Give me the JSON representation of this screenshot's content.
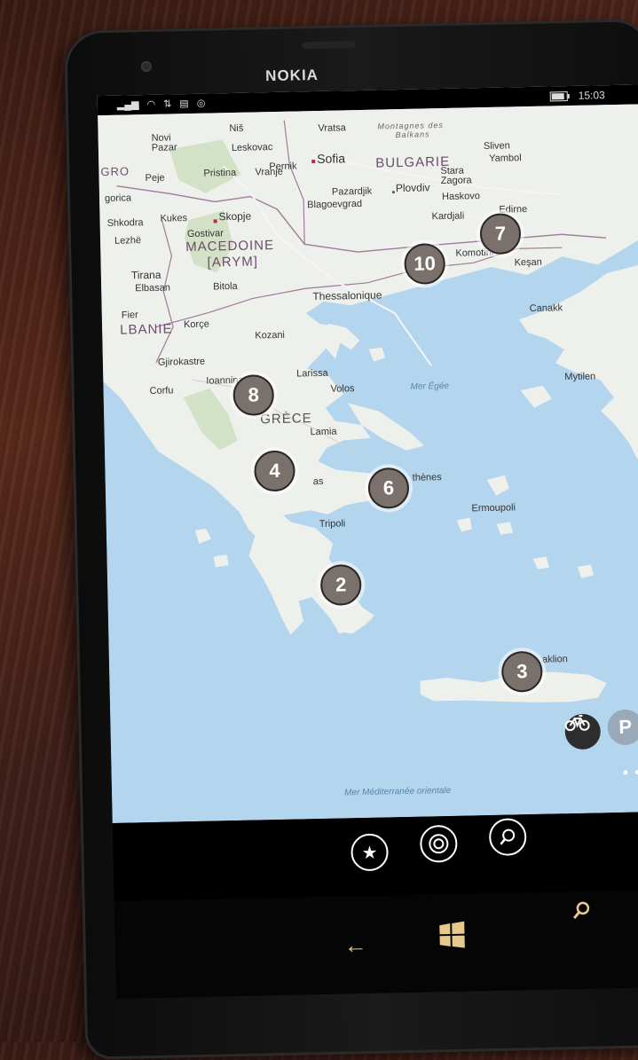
{
  "device": {
    "brand": "NOKIA"
  },
  "status": {
    "time": "15:03",
    "icons": [
      "signal-icon",
      "wifi-icon",
      "data-icon",
      "message-icon",
      "location-icon"
    ]
  },
  "map": {
    "countries": [
      "BULGARIE",
      "MACEDOINE",
      "[ARYM]",
      "GRÈCE",
      "LBANIE",
      "GRO"
    ],
    "seas": [
      "Mer Égée",
      "Mer Méditerranée orientale"
    ],
    "ranges": [
      "Montagnes des",
      "Balkans"
    ],
    "cities": {
      "sofia": "Sofia",
      "skopje": "Skopje",
      "thessalonique": "Thessalonique",
      "plovdiv": "Plovdiv",
      "pristina": "Pristina",
      "leskovac": "Leskovac",
      "nis": "Niš",
      "vratsa": "Vratsa",
      "novi_pazar": "Novi\nPazar",
      "pernik": "Pernik",
      "vranje": "Vranje",
      "pazardjik": "Pazardjik",
      "blagoevgrad": "Blagoevgrad",
      "stara_zagora": "Stara\nZagora",
      "sliven": "Sliven",
      "yambol": "Yambol",
      "haskovo": "Haskovo",
      "kardjali": "Kardjali",
      "edirne": "Edirne",
      "komotini": "Komotini",
      "kesan": "Keşan",
      "canakkale": "Canakk",
      "mytilene": "Mytilen",
      "peje": "Peje",
      "podgorica": "gorica",
      "shkodra": "Shkodra",
      "lezhe": "Lezhë",
      "kukes": "Kukes",
      "gostivar": "Gostivar",
      "tirana": "Tirana",
      "elbasan": "Elbasan",
      "bitola": "Bitola",
      "fier": "Fier",
      "korce": "Korçe",
      "kozani": "Kozani",
      "gjirokastre": "Gjirokastre",
      "corfu": "Corfu",
      "ioannina": "Ioannina",
      "larissa": "Larissa",
      "volos": "Volos",
      "lamia": "Lamia",
      "athenes": "thènes",
      "patras": "as",
      "tripoli": "Tripoli",
      "ermoupoli": "Ermoupoli",
      "heraklion": "aklion"
    },
    "clusters": [
      {
        "id": "c10",
        "count": "10"
      },
      {
        "id": "c7",
        "count": "7"
      },
      {
        "id": "c8",
        "count": "8"
      },
      {
        "id": "c4",
        "count": "4"
      },
      {
        "id": "c6",
        "count": "6"
      },
      {
        "id": "c2",
        "count": "2"
      },
      {
        "id": "c3",
        "count": "3"
      }
    ],
    "parking_label": "P",
    "more": "• • •"
  },
  "appbar": {
    "buttons": [
      "favorites-star-icon",
      "nearby-target-icon",
      "search-icon"
    ]
  },
  "navbar": {
    "buttons": [
      "back-arrow-icon",
      "windows-start-icon",
      "bing-search-icon"
    ]
  },
  "colors": {
    "water": "#b3d6ee",
    "land": "#eef0ec",
    "cluster": "#7a716c",
    "cluster_border": "#2b2523"
  }
}
